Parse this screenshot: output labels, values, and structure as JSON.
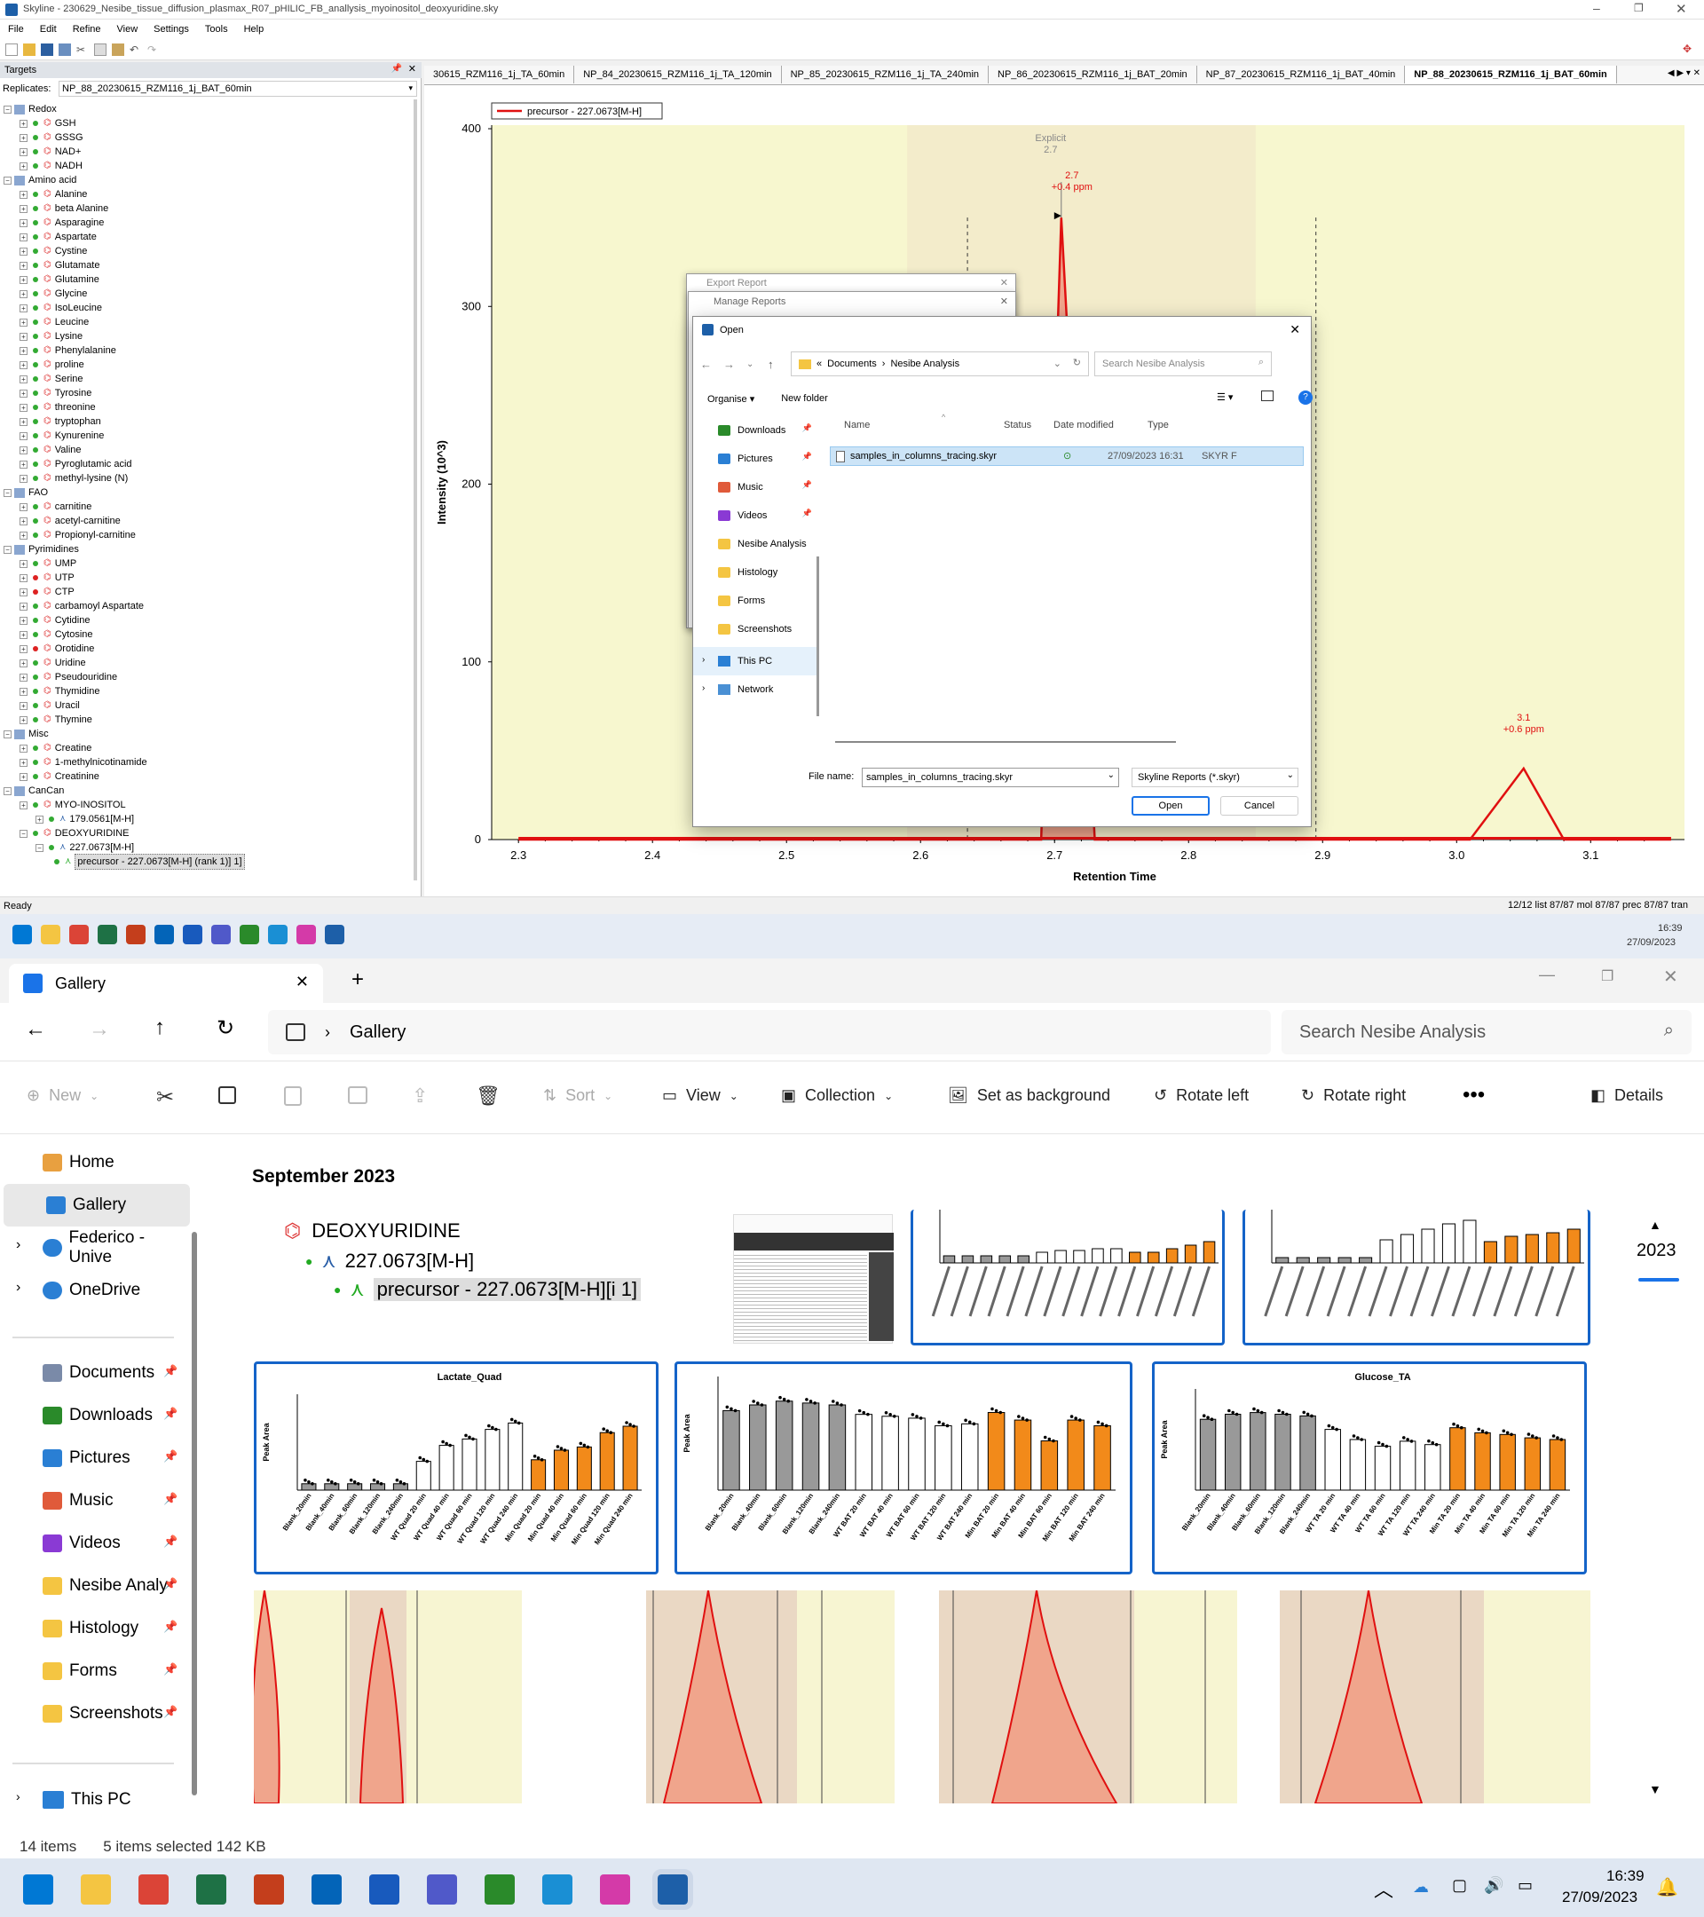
{
  "skyline": {
    "title": "Skyline - 230629_Nesibe_tissue_diffusion_plasmax_R07_pHILIC_FB_anallysis_myoinositol_deoxyuridine.sky",
    "menu": [
      "File",
      "Edit",
      "Refine",
      "View",
      "Settings",
      "Tools",
      "Help"
    ],
    "targets_panel_title": "Targets",
    "replicates_label": "Replicates:",
    "replicate_value": "NP_88_20230615_RZM116_1j_BAT_60min",
    "tree": [
      {
        "label": "Redox",
        "group": true,
        "items": [
          {
            "l": "GSH",
            "s": "green"
          },
          {
            "l": "GSSG",
            "s": "green"
          },
          {
            "l": "NAD+",
            "s": "green"
          },
          {
            "l": "NADH",
            "s": "green"
          }
        ]
      },
      {
        "label": "Amino acid",
        "group": true,
        "items": [
          {
            "l": "Alanine",
            "s": "green"
          },
          {
            "l": "beta Alanine",
            "s": "green"
          },
          {
            "l": "Asparagine",
            "s": "green"
          },
          {
            "l": "Aspartate",
            "s": "green"
          },
          {
            "l": "Cystine",
            "s": "green"
          },
          {
            "l": "Glutamate",
            "s": "green"
          },
          {
            "l": "Glutamine",
            "s": "green"
          },
          {
            "l": "Glycine",
            "s": "green"
          },
          {
            "l": "IsoLeucine",
            "s": "green"
          },
          {
            "l": "Leucine",
            "s": "green"
          },
          {
            "l": "Lysine",
            "s": "green"
          },
          {
            "l": "Phenylalanine",
            "s": "green"
          },
          {
            "l": "proline",
            "s": "green"
          },
          {
            "l": "Serine",
            "s": "green"
          },
          {
            "l": "Tyrosine",
            "s": "green"
          },
          {
            "l": "threonine",
            "s": "green"
          },
          {
            "l": "tryptophan",
            "s": "green"
          },
          {
            "l": "Kynurenine",
            "s": "green"
          },
          {
            "l": "Valine",
            "s": "green"
          },
          {
            "l": "Pyroglutamic acid",
            "s": "green"
          },
          {
            "l": "methyl-lysine (N)",
            "s": "green"
          }
        ]
      },
      {
        "label": "FAO",
        "group": true,
        "items": [
          {
            "l": "carnitine",
            "s": "green"
          },
          {
            "l": "acetyl-carnitine",
            "s": "green"
          },
          {
            "l": "Propionyl-carnitine",
            "s": "green"
          }
        ]
      },
      {
        "label": "Pyrimidines",
        "group": true,
        "items": [
          {
            "l": "UMP",
            "s": "green"
          },
          {
            "l": "UTP",
            "s": "red"
          },
          {
            "l": "CTP",
            "s": "red"
          },
          {
            "l": "carbamoyl Aspartate",
            "s": "green"
          },
          {
            "l": "Cytidine",
            "s": "green"
          },
          {
            "l": "Cytosine",
            "s": "green"
          },
          {
            "l": "Orotidine",
            "s": "red"
          },
          {
            "l": "Uridine",
            "s": "green"
          },
          {
            "l": "Pseudouridine",
            "s": "green"
          },
          {
            "l": "Thymidine",
            "s": "green"
          },
          {
            "l": "Uracil",
            "s": "green"
          },
          {
            "l": "Thymine",
            "s": "green"
          }
        ]
      },
      {
        "label": "Misc",
        "group": true,
        "items": [
          {
            "l": "Creatine",
            "s": "green"
          },
          {
            "l": "1-methylnicotinamide",
            "s": "green"
          },
          {
            "l": "Creatinine",
            "s": "green"
          }
        ]
      }
    ],
    "cancan": {
      "label": "CanCan",
      "myo": "MYO-INOSITOL",
      "myo_ion": "179.0561[M-H]",
      "deoxy": "DEOXYURIDINE",
      "deoxy_ion": "227.0673[M-H]",
      "precursor": "precursor - 227.0673[M-H] (rank 1)] 1]"
    },
    "tabs": [
      "30615_RZM116_1j_TA_60min",
      "NP_84_20230615_RZM116_1j_TA_120min",
      "NP_85_20230615_RZM116_1j_TA_240min",
      "NP_86_20230615_RZM116_1j_BAT_20min",
      "NP_87_20230615_RZM116_1j_BAT_40min",
      "NP_88_20230615_RZM116_1j_BAT_60min"
    ],
    "legend": "precursor - 227.0673[M-H]",
    "yaxis_label": "Intensity (10^3)",
    "xaxis_label": "Retention Time",
    "yticks": [
      "400",
      "300",
      "200",
      "100",
      "0"
    ],
    "xticks": [
      "2.3",
      "2.4",
      "2.5",
      "2.6",
      "2.7",
      "2.8",
      "2.9",
      "3.0",
      "3.1"
    ],
    "peak1_explicit": "Explicit",
    "peak1_explicit_val": "2.7",
    "peak1_rt": "2.7",
    "peak1_ppm": "+0.4 ppm",
    "peak2_rt": "3.1",
    "peak2_ppm": "+0.6 ppm",
    "status_left": "Ready",
    "status_right": "12/12 list   87/87 mol   87/87 prec   87/87 tran",
    "clock_time": "16:39",
    "clock_date": "27/09/2023"
  },
  "dialogs": {
    "export_title": "Export Report",
    "manage_title": "Manage Reports",
    "open_title": "Open",
    "path": [
      "«",
      "Documents",
      "›",
      "Nesibe Analysis"
    ],
    "search_placeholder": "Search Nesibe Analysis",
    "organise": "Organise ▾",
    "new_folder": "New folder",
    "nav": [
      {
        "l": "Downloads",
        "i": "download",
        "pin": true
      },
      {
        "l": "Pictures",
        "i": "pictures",
        "pin": true
      },
      {
        "l": "Music",
        "i": "music",
        "pin": true
      },
      {
        "l": "Videos",
        "i": "videos",
        "pin": true
      },
      {
        "l": "Nesibe Analysis",
        "i": "folder",
        "pin": false
      },
      {
        "l": "Histology",
        "i": "folder",
        "pin": false
      },
      {
        "l": "Forms",
        "i": "folder",
        "pin": false
      },
      {
        "l": "Screenshots",
        "i": "folder",
        "pin": false
      }
    ],
    "this_pc": "This PC",
    "network": "Network",
    "cols": {
      "name": "Name",
      "status": "Status",
      "date": "Date modified",
      "type": "Type"
    },
    "file": {
      "name": "samples_in_columns_tracing.skyr",
      "date": "27/09/2023 16:31",
      "type": "SKYR F"
    },
    "filename_label": "File name:",
    "filename_value": "samples_in_columns_tracing.skyr",
    "filetype": "Skyline Reports (*.skyr)",
    "open_btn": "Open",
    "cancel_btn": "Cancel"
  },
  "gallery": {
    "tab_title": "Gallery",
    "breadcrumb": "Gallery",
    "search_placeholder": "Search Nesibe Analysis",
    "toolbar": {
      "new": "New",
      "sort": "Sort",
      "view": "View",
      "collection": "Collection",
      "set_bg": "Set as background",
      "rotate_left": "Rotate left",
      "rotate_right": "Rotate right",
      "details": "Details"
    },
    "sidebar": [
      {
        "l": "Home",
        "i": "home"
      },
      {
        "l": "Gallery",
        "i": "gallery",
        "active": true
      },
      {
        "l": "Federico - Unive",
        "i": "cloud"
      },
      {
        "l": "OneDrive",
        "i": "cloud"
      }
    ],
    "sidebar2": [
      {
        "l": "Documents",
        "i": "documents"
      },
      {
        "l": "Downloads",
        "i": "download"
      },
      {
        "l": "Pictures",
        "i": "pictures"
      },
      {
        "l": "Music",
        "i": "music"
      },
      {
        "l": "Videos",
        "i": "videos"
      },
      {
        "l": "Nesibe Analy",
        "i": "folder"
      },
      {
        "l": "Histology",
        "i": "folder"
      },
      {
        "l": "Forms",
        "i": "folder"
      },
      {
        "l": "Screenshots",
        "i": "folder"
      }
    ],
    "this_pc": "This PC",
    "section": "September 2023",
    "year": "2023",
    "status_items": "14 items",
    "status_selected": "5 items selected  142 KB",
    "crop_tree": {
      "deoxy": "DEOXYURIDINE",
      "ion": "227.0673[M-H]",
      "prec": "precursor - 227.0673[M-H][i 1]"
    },
    "chart_titles": [
      "Lactate_Quad",
      "",
      "Glucose_TA"
    ],
    "time": "16:39",
    "date": "27/09/2023"
  },
  "chart_data": [
    {
      "type": "line",
      "series": [
        {
          "name": "precursor - 227.0673[M-H]",
          "points": [
            [
              2.3,
              0
            ],
            [
              2.69,
              0
            ],
            [
              2.705,
              350
            ],
            [
              2.73,
              0
            ],
            [
              3.01,
              0
            ],
            [
              3.05,
              40
            ],
            [
              3.08,
              0
            ],
            [
              3.16,
              0
            ]
          ]
        }
      ],
      "xlabel": "Retention Time",
      "ylabel": "Intensity (10^3)",
      "xlim": [
        2.28,
        3.17
      ],
      "ylim": [
        0,
        400
      ]
    },
    {
      "type": "bar",
      "title": "Lactate_Quad",
      "ylabel": "Peak Area",
      "categories": [
        "Blank_20min",
        "Blank_40min",
        "Blank_60min",
        "Blank_120min",
        "Blank_240min",
        "WT Quad 20 min",
        "WT Quad 40 min",
        "WT Quad 60 min",
        "WT Quad 120 min",
        "WT Quad 240 min",
        "Min Quad 20 min",
        "Min Quad 40 min",
        "Min Quad 60 min",
        "Min Quad 120 min",
        "Min Quad 240 min"
      ],
      "values": [
        0.2,
        0.2,
        0.2,
        0.2,
        0.2,
        0.9,
        1.4,
        1.6,
        1.9,
        2.1,
        0.95,
        1.25,
        1.35,
        1.8,
        2.0
      ]
    },
    {
      "type": "bar",
      "title": "",
      "ylabel": "Peak Area",
      "categories": [
        "Blank_20min",
        "Blank_40min",
        "Blank_60min",
        "Blank_120min",
        "Blank_240min",
        "WT BAT 20 min",
        "WT BAT 40 min",
        "WT BAT 60 min",
        "WT BAT 120 min",
        "WT BAT 240 min",
        "Min BAT 20 min",
        "Min BAT 40 min",
        "Min BAT 60 min",
        "Min BAT 120 min",
        "Min BAT 240 min"
      ],
      "values": [
        2.1,
        2.25,
        2.35,
        2.3,
        2.25,
        2.0,
        1.95,
        1.9,
        1.7,
        1.75,
        2.05,
        1.85,
        1.3,
        1.85,
        1.7
      ]
    },
    {
      "type": "bar",
      "title": "Glucose_TA",
      "ylabel": "Peak Area",
      "categories": [
        "Blank_20min",
        "Blank_40min",
        "Blank_60min",
        "Blank_120min",
        "Blank_240min",
        "WT TA 20 min",
        "WT TA 40 min",
        "WT TA 60 min",
        "WT TA 120 min",
        "WT TA 240 min",
        "Min TA 20 min",
        "Min TA 40 min",
        "Min TA 60 min",
        "Min TA 120 min",
        "Min TA 240 min"
      ],
      "values": [
        2.1,
        2.25,
        2.3,
        2.25,
        2.2,
        1.8,
        1.5,
        1.3,
        1.45,
        1.35,
        1.85,
        1.7,
        1.65,
        1.55,
        1.5
      ]
    }
  ]
}
